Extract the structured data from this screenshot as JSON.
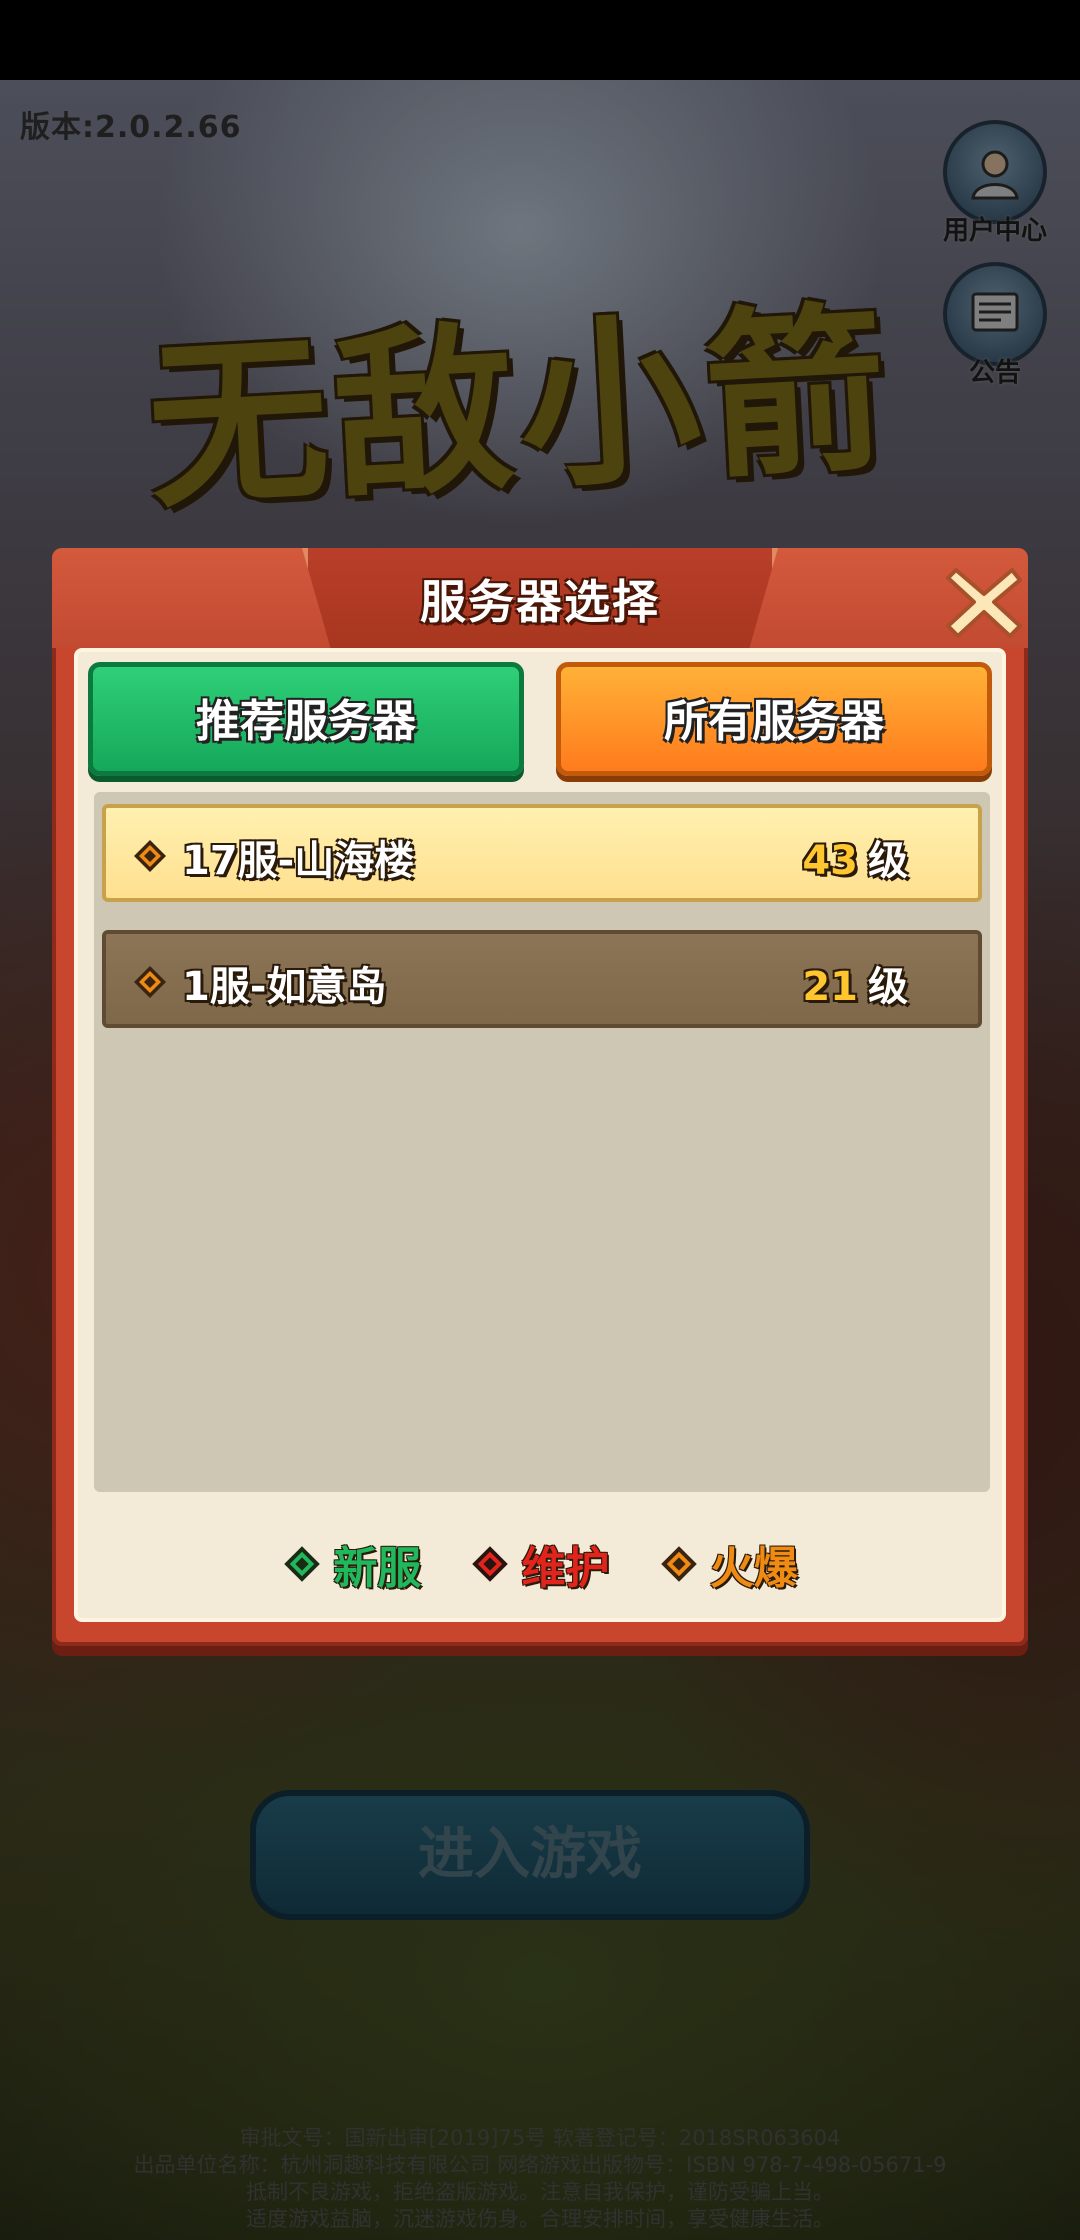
{
  "version": "版本:2.0.2.66",
  "side_buttons": {
    "user_center": "用户中心",
    "notice": "公告"
  },
  "logo_text": "无敌小箭箭",
  "dialog": {
    "title": "服务器选择",
    "tabs": [
      {
        "label": "推荐服务器",
        "active": false
      },
      {
        "label": "所有服务器",
        "active": true
      }
    ],
    "servers": [
      {
        "name": "17服-山海楼",
        "level": "43",
        "level_unit": "级",
        "selected": true
      },
      {
        "name": "1服-如意岛",
        "level": "21",
        "level_unit": "级",
        "selected": false
      }
    ],
    "legend": [
      {
        "label": "新服",
        "color": "#1fb85c"
      },
      {
        "label": "维护",
        "color": "#e3241c"
      },
      {
        "label": "火爆",
        "color": "#ef8a12"
      }
    ]
  },
  "enter_button": "进入游戏",
  "footer": [
    "审批文号：国新出审[2019]75号      软著登记号：2018SR063604",
    "出品单位名称：杭州洞趣科技有限公司      网络游戏出版物号：ISBN 978-7-498-05671-9",
    "抵制不良游戏，拒绝盗版游戏。注意自我保护，谨防受骗上当。",
    "适度游戏益脑，沉迷游戏伤身。合理安排时间，享受健康生活。"
  ]
}
